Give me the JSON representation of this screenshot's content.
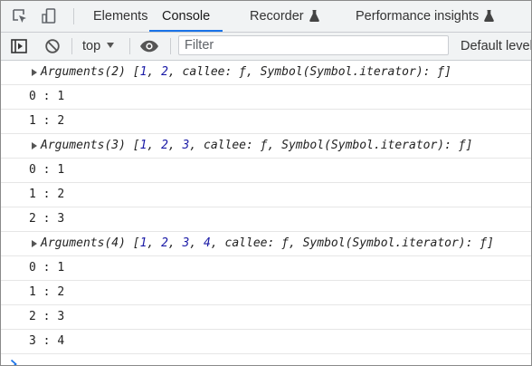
{
  "tabs": [
    {
      "label": "Elements",
      "active": false
    },
    {
      "label": "Console",
      "active": true
    },
    {
      "label": "Recorder",
      "active": false,
      "experimental": true
    },
    {
      "label": "Performance insights",
      "active": false,
      "experimental": true
    }
  ],
  "toolbar": {
    "context": "top",
    "filter_placeholder": "Filter",
    "filter_value": "",
    "levels_label": "Default levels"
  },
  "console": {
    "groups": [
      {
        "header": "Arguments(2)",
        "preview": {
          "open": "[",
          "nums": [
            "1",
            "2"
          ],
          "rest": "callee: ƒ, Symbol(Symbol.iterator): ƒ]"
        },
        "entries": [
          [
            "0",
            "1"
          ],
          [
            "1",
            "2"
          ]
        ]
      },
      {
        "header": "Arguments(3)",
        "preview": {
          "open": "[",
          "nums": [
            "1",
            "2",
            "3"
          ],
          "rest": "callee: ƒ, Symbol(Symbol.iterator): ƒ]"
        },
        "entries": [
          [
            "0",
            "1"
          ],
          [
            "1",
            "2"
          ],
          [
            "2",
            "3"
          ]
        ]
      },
      {
        "header": "Arguments(4)",
        "preview": {
          "open": "[",
          "nums": [
            "1",
            "2",
            "3",
            "4"
          ],
          "rest": "callee: ƒ, Symbol(Symbol.iterator): ƒ]"
        },
        "entries": [
          [
            "0",
            "1"
          ],
          [
            "1",
            "2"
          ],
          [
            "2",
            "3"
          ],
          [
            "3",
            "4"
          ]
        ]
      }
    ],
    "separator": " : "
  },
  "colors": {
    "accent": "#1a73e8",
    "number": "#1a1aa6",
    "prompt": "#1a73e8"
  }
}
